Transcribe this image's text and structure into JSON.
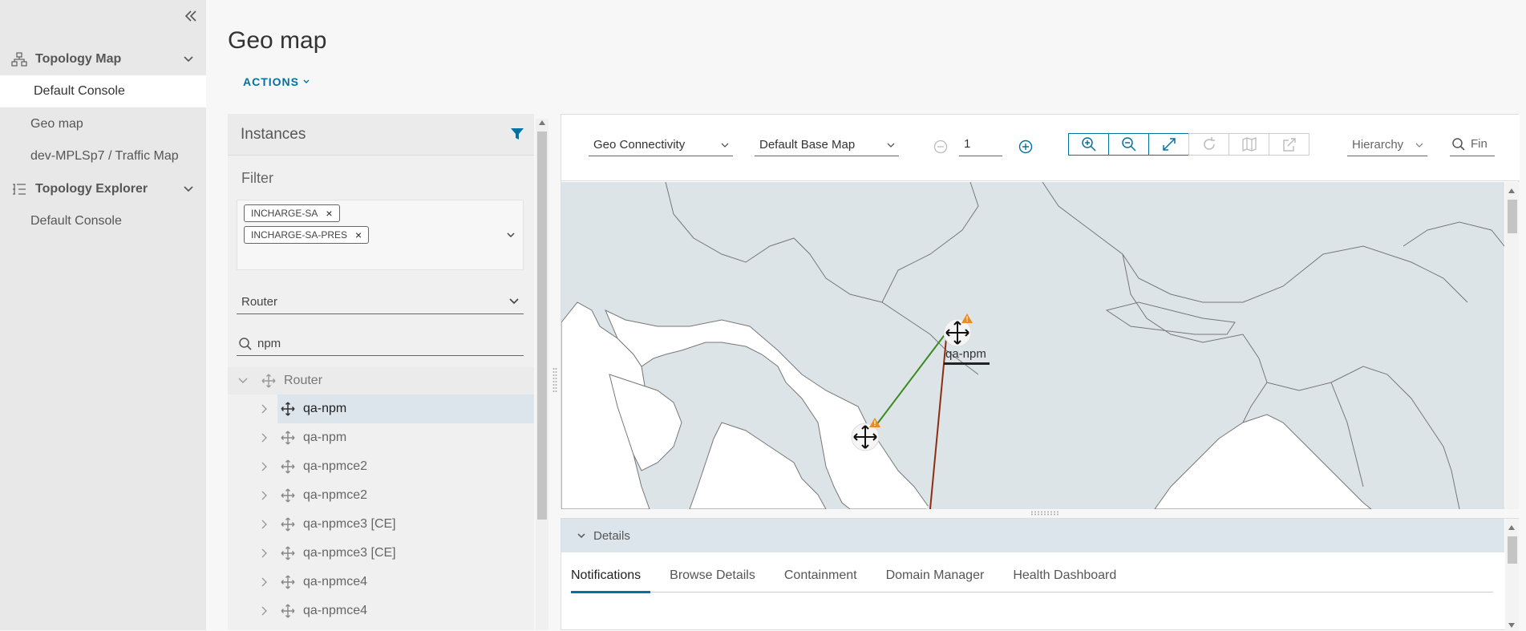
{
  "sidebar": {
    "groups": [
      {
        "label": "Topology Map",
        "icon": "topology-map-icon",
        "items": [
          {
            "label": "Default Console",
            "active": true
          },
          {
            "label": "Geo map",
            "active": false
          },
          {
            "label": "dev-MPLSp7 / Traffic Map",
            "active": false
          }
        ]
      },
      {
        "label": "Topology Explorer",
        "icon": "topology-explorer-icon",
        "items": [
          {
            "label": "Default Console",
            "active": false
          }
        ]
      }
    ]
  },
  "header": {
    "title": "Geo map",
    "actions_label": "ACTIONS"
  },
  "instances": {
    "title": "Instances",
    "filter_label": "Filter",
    "tags": [
      "INCHARGE-SA",
      "INCHARGE-SA-PRES"
    ],
    "class_select": "Router",
    "search_value": "npm",
    "tree_root": "Router",
    "tree_items": [
      {
        "label": "qa-npm",
        "selected": true
      },
      {
        "label": "qa-npm",
        "selected": false
      },
      {
        "label": "qa-npmce2",
        "selected": false
      },
      {
        "label": "qa-npmce2",
        "selected": false
      },
      {
        "label": "qa-npmce3 [CE]",
        "selected": false
      },
      {
        "label": "qa-npmce3 [CE]",
        "selected": false
      },
      {
        "label": "qa-npmce4",
        "selected": false
      },
      {
        "label": "qa-npmce4",
        "selected": false
      }
    ]
  },
  "toolbar": {
    "map_type": "Geo Connectivity",
    "base_map": "Default Base Map",
    "zoom_value": "1",
    "layout": "Hierarchy",
    "find_placeholder": "Fin"
  },
  "map": {
    "node_label": "qa-npm",
    "link_colors": {
      "green": "#3a8a1f",
      "brown": "#8b2e12"
    },
    "alert_color": "#f18a1c"
  },
  "details": {
    "title": "Details",
    "tabs": [
      {
        "label": "Notifications",
        "active": true
      },
      {
        "label": "Browse Details",
        "active": false
      },
      {
        "label": "Containment",
        "active": false
      },
      {
        "label": "Domain Manager",
        "active": false
      },
      {
        "label": "Health Dashboard",
        "active": false
      }
    ]
  },
  "colors": {
    "accent": "#0072a3",
    "sidebar_bg": "#e8e8e8",
    "map_sea": "#dde4e8"
  }
}
